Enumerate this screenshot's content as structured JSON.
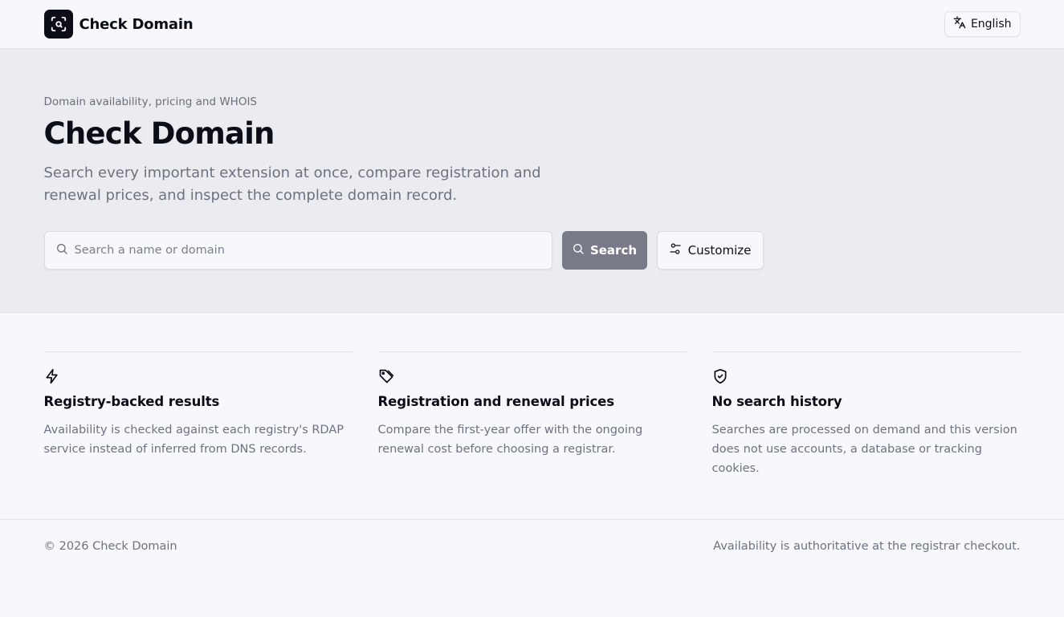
{
  "header": {
    "brand_name": "Check Domain",
    "brand_icon": "scan-search-icon",
    "language_label": "English",
    "language_icon": "translate-icon"
  },
  "hero": {
    "eyebrow": "Domain availability, pricing and WHOIS",
    "title": "Check Domain",
    "description": "Search every important extension at once, compare registration and renewal prices, and inspect the complete domain record."
  },
  "search": {
    "placeholder": "Search a name or domain",
    "value": "",
    "search_label": "Search",
    "customize_label": "Customize"
  },
  "features": [
    {
      "icon": "zap-icon",
      "title": "Registry-backed results",
      "description": "Availability is checked against each registry's RDAP service instead of inferred from DNS records."
    },
    {
      "icon": "tag-icon",
      "title": "Registration and renewal prices",
      "description": "Compare the first-year offer with the ongoing renewal cost before choosing a registrar."
    },
    {
      "icon": "shield-check-icon",
      "title": "No search history",
      "description": "Searches are processed on demand and this version does not use accounts, a database or tracking cookies."
    }
  ],
  "footer": {
    "copyright": "© 2026 Check Domain",
    "note": "Availability is authoritative at the registrar checkout."
  },
  "colors": {
    "primary_text": "#0b0d17",
    "muted_text": "#6d7280",
    "hero_bg": "#ebecf0",
    "search_button_bg": "#787b87"
  }
}
